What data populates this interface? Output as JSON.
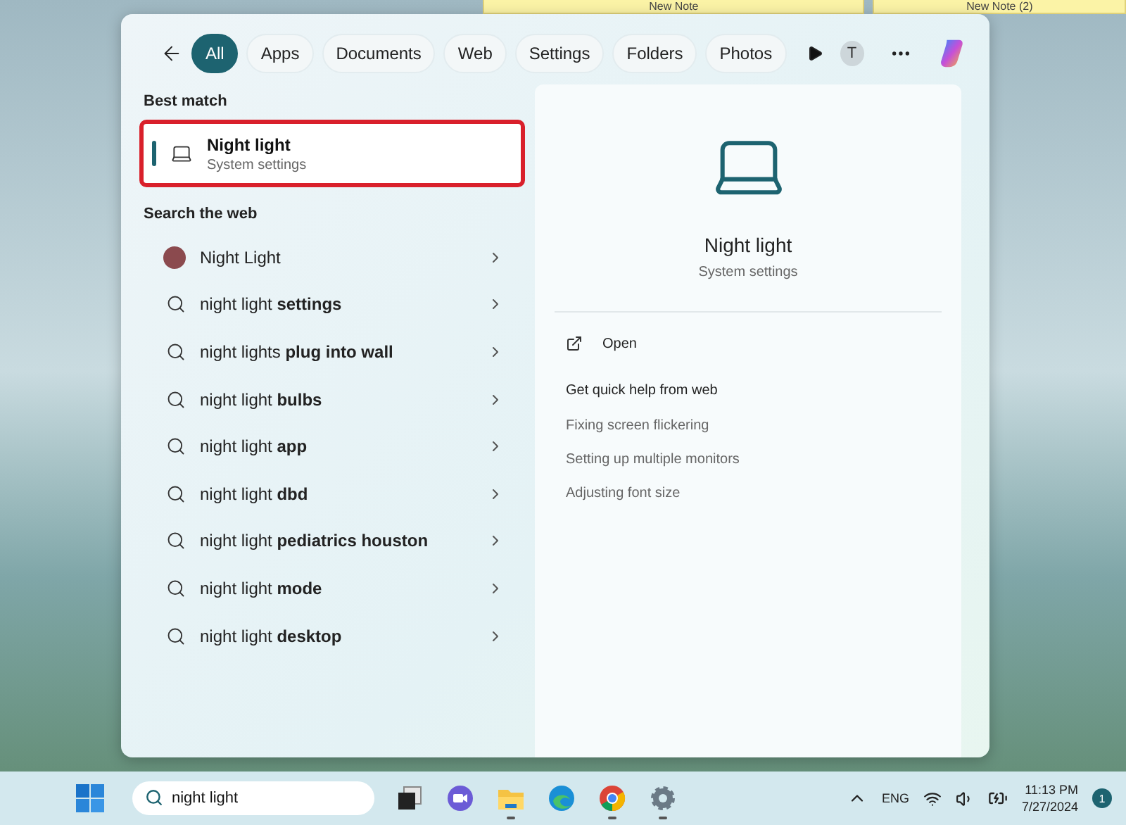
{
  "desktop": {
    "sticky_notes": [
      {
        "title": "New Note"
      },
      {
        "title": "New Note (2)"
      }
    ]
  },
  "search_panel": {
    "filters": [
      {
        "label": "All",
        "selected": true
      },
      {
        "label": "Apps",
        "selected": false
      },
      {
        "label": "Documents",
        "selected": false
      },
      {
        "label": "Web",
        "selected": false
      },
      {
        "label": "Settings",
        "selected": false
      },
      {
        "label": "Folders",
        "selected": false
      },
      {
        "label": "Photos",
        "selected": false
      }
    ],
    "account_initial": "T",
    "best_match": {
      "heading": "Best match",
      "item": {
        "title": "Night light",
        "subtitle": "System settings",
        "selected": true,
        "annotated": true
      }
    },
    "web": {
      "heading": "Search the web",
      "results": [
        {
          "kind": "entity",
          "text": "Night Light"
        },
        {
          "kind": "query",
          "text": "night light **settings**"
        },
        {
          "kind": "query",
          "text": "night lights **plug into wall**"
        },
        {
          "kind": "query",
          "text": "night light **bulbs**"
        },
        {
          "kind": "query",
          "text": "night light **app**"
        },
        {
          "kind": "query",
          "text": "night light **dbd**"
        },
        {
          "kind": "query",
          "text": "night light **pediatrics houston**"
        },
        {
          "kind": "query",
          "text": "night light **mode**"
        },
        {
          "kind": "query",
          "text": "night light **desktop**"
        }
      ]
    },
    "detail": {
      "title": "Night light",
      "subtitle": "System settings",
      "actions": [
        {
          "label": "Open"
        }
      ],
      "help_heading": "Get quick help from web",
      "help_links": [
        "Fixing screen flickering",
        "Setting up multiple monitors",
        "Adjusting font size"
      ]
    }
  },
  "taskbar": {
    "search_value": "night light",
    "apps": [
      {
        "kind": "windows",
        "running": false
      },
      {
        "kind": "video",
        "running": false
      },
      {
        "kind": "folder",
        "running": true
      },
      {
        "kind": "edge",
        "running": false
      },
      {
        "kind": "chrome",
        "running": true
      },
      {
        "kind": "gear",
        "running": true
      }
    ],
    "language": "ENG",
    "time": "11:13 PM",
    "date": "7/27/2024",
    "notification_count": "1"
  }
}
